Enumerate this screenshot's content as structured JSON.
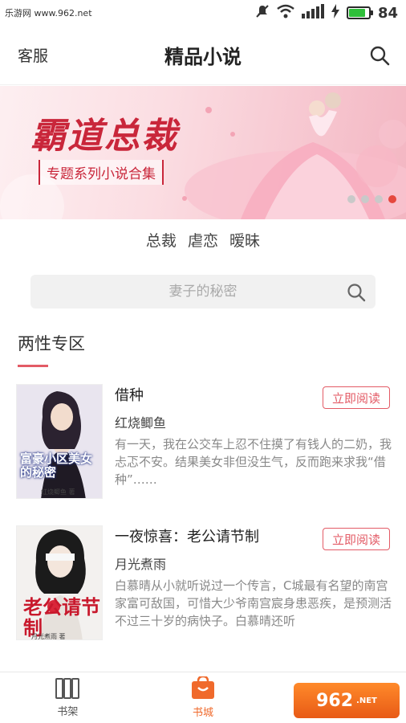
{
  "status_bar": {
    "watermark_text": "乐游网 www.962.net",
    "battery_percent": "84",
    "battery_level": 0.84
  },
  "header": {
    "service_label": "客服",
    "title": "精品小说",
    "search_icon": "search-icon"
  },
  "banner": {
    "headline": "霸道总裁",
    "subtitle": "专题系列小说合集",
    "dots_count": 4,
    "active_dot": 4
  },
  "tags": [
    "总裁",
    "虐恋",
    "暧昧"
  ],
  "search": {
    "placeholder": "妻子的秘密"
  },
  "section": {
    "title": "两性专区"
  },
  "books": [
    {
      "name": "借种",
      "author": "红烧鲫鱼",
      "description": "有一天，我在公交车上忍不住摸了有钱人的二奶，我忐忑不安。结果美女非但没生气，反而跑来求我“借种”……",
      "button": "立即阅读",
      "cover_title": "富豪小区美女的秘密",
      "cover_author": "红烧鲫鱼 著"
    },
    {
      "name": "一夜惊喜：老公请节制",
      "author": "月光煮雨",
      "description": "白慕晴从小就听说过一个传言，C城最有名望的南宫家富可敌国，可惜大少爷南宫宸身患恶疾，是预测活不过三十岁的病快子。白慕晴还听",
      "button": "立即阅读",
      "cover_title": "老公请节制",
      "cover_author": "月光煮雨 著"
    }
  ],
  "bottom_nav": [
    {
      "label": "书架",
      "icon": "bookshelf-icon",
      "active": false
    },
    {
      "label": "书城",
      "icon": "bookstore-bag-icon",
      "active": true
    },
    {
      "label": "",
      "icon": "user-icon",
      "active": false
    }
  ],
  "colors": {
    "accent": "#e35b66",
    "active_tab": "#f06a2c",
    "dot_active": "#e5483e"
  }
}
